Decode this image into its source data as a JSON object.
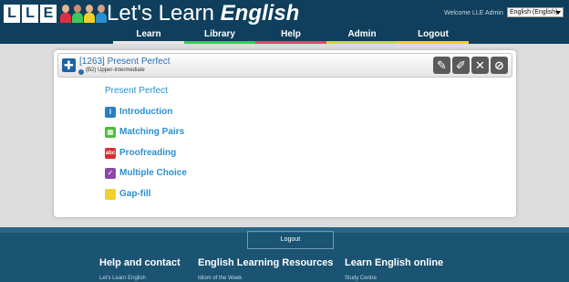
{
  "header": {
    "logo_letters": [
      "L",
      "L",
      "E"
    ],
    "title_plain": "Let's Learn ",
    "title_emphasis": "English",
    "welcome": "Welcome LLE Admin",
    "language": "English (English)"
  },
  "nav": [
    {
      "label": "Learn",
      "color": "#e8e8e8"
    },
    {
      "label": "Library",
      "color": "#3ec85a"
    },
    {
      "label": "Help",
      "color": "#e0486a"
    },
    {
      "label": "Admin",
      "color": "#c6d844"
    },
    {
      "label": "Logout",
      "color": "#f0d02a"
    }
  ],
  "panel": {
    "title": "[1263] Present Perfect",
    "level": "(B2) Upper-Intermediate",
    "content_title": "Present Perfect",
    "items": [
      {
        "label": "Introduction",
        "icon": "info-icon",
        "color": "#2a7fc4"
      },
      {
        "label": "Matching Pairs",
        "icon": "matching-pairs-icon",
        "color": "#4cbc3a"
      },
      {
        "label": "Proofreading",
        "icon": "proofreading-icon",
        "color": "#d63030"
      },
      {
        "label": "Multiple Choice",
        "icon": "multiple-choice-icon",
        "color": "#8a4aa8"
      },
      {
        "label": "Gap-fill",
        "icon": "gap-fill-icon",
        "color": "#f0d02a"
      }
    ]
  },
  "footer": {
    "logout": "Logout",
    "col1_heading": "Help and contact",
    "col1_link": "Let's Learn English",
    "col2_heading": "English Learning Resources",
    "col2_link": "Idiom of the Week",
    "col3_heading": "Learn English online",
    "col3_link": "Study Centre"
  },
  "colors": {
    "header_bg": "#0f3f5c",
    "footer_bg": "#1b5373",
    "accent_blue": "#2a8fd0"
  }
}
